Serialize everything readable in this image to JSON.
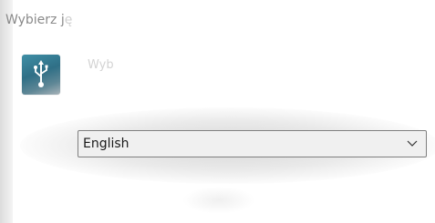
{
  "window": {
    "title_visible": "Wybierz j",
    "title_faded": "ę"
  },
  "header": {
    "prompt_text": "Wyb",
    "icon": "usb-icon",
    "icon_colors": [
      "#3f8fa6",
      "#2f6f86",
      "#a9b4ba"
    ]
  },
  "language_select": {
    "selected": "English",
    "icon": "chevron-down-icon"
  }
}
